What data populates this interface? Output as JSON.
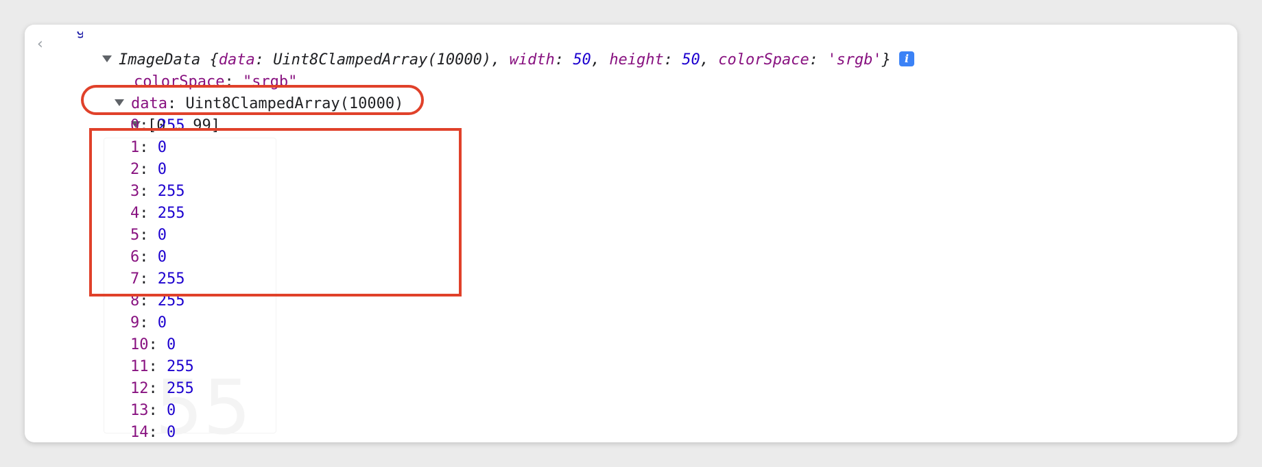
{
  "console": {
    "summary": {
      "class_name": "ImageData",
      "open_brace": " {",
      "data_key": "data",
      "data_value": "Uint8ClampedArray(10000)",
      "width_key": "width",
      "width_value": "50",
      "height_key": "height",
      "height_value": "50",
      "colorspace_key": "colorSpace",
      "colorspace_value": "'srgb'",
      "close_brace": "}"
    },
    "colorspace_row": {
      "key": "colorSpace",
      "value": "\"srgb\""
    },
    "data_row": {
      "key": "data",
      "value": "Uint8ClampedArray(10000)"
    },
    "range_row": {
      "label": "[0 … 99]"
    },
    "entries": [
      {
        "index": "0",
        "value": "255"
      },
      {
        "index": "1",
        "value": "0"
      },
      {
        "index": "2",
        "value": "0"
      },
      {
        "index": "3",
        "value": "255"
      },
      {
        "index": "4",
        "value": "255"
      },
      {
        "index": "5",
        "value": "0"
      },
      {
        "index": "6",
        "value": "0"
      },
      {
        "index": "7",
        "value": "255"
      },
      {
        "index": "8",
        "value": "255"
      },
      {
        "index": "9",
        "value": "0"
      },
      {
        "index": "10",
        "value": "0"
      },
      {
        "index": "11",
        "value": "255"
      },
      {
        "index": "12",
        "value": "255"
      },
      {
        "index": "13",
        "value": "0"
      },
      {
        "index": "14",
        "value": "0"
      }
    ],
    "watermark_text": "55"
  },
  "annotation_color": "#e0412a",
  "key_color": "#881280",
  "number_color": "#1c00cf"
}
